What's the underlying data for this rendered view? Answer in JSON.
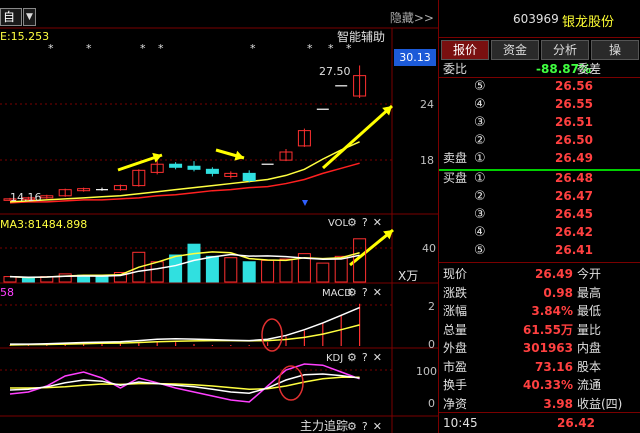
{
  "toolbar": {
    "watchlist_label": "自选",
    "dropdown_glyph": "▼",
    "hide_label": "隐藏>>"
  },
  "main_chart": {
    "ma_label": "E:15.253",
    "smart_assist_label": "智能辅助",
    "current_price_tag": "30.13",
    "high_label": "27.50",
    "low_label": "14.16",
    "axis_ticks": [
      "24",
      "18"
    ],
    "markers": [
      "*",
      "*",
      "*",
      "*",
      "*",
      "*",
      "*",
      "*"
    ],
    "candles": [
      {
        "o": 14.3,
        "c": 14.4,
        "h": 14.5,
        "l": 14.2
      },
      {
        "o": 14.4,
        "c": 14.5,
        "h": 14.6,
        "l": 14.3
      },
      {
        "o": 14.5,
        "c": 14.7,
        "h": 14.8,
        "l": 14.4
      },
      {
        "o": 14.7,
        "c": 15.3,
        "h": 15.4,
        "l": 14.6
      },
      {
        "o": 15.2,
        "c": 15.4,
        "h": 15.5,
        "l": 15.1
      },
      {
        "o": 15.3,
        "c": 15.3,
        "h": 15.5,
        "l": 15.2
      },
      {
        "o": 15.3,
        "c": 15.7,
        "h": 15.8,
        "l": 15.2
      },
      {
        "o": 15.7,
        "c": 17.2,
        "h": 17.3,
        "l": 15.6
      },
      {
        "o": 17.0,
        "c": 17.8,
        "h": 18.3,
        "l": 16.8
      },
      {
        "o": 17.8,
        "c": 17.5,
        "h": 18.0,
        "l": 17.3
      },
      {
        "o": 17.6,
        "c": 17.3,
        "h": 18.1,
        "l": 17.1
      },
      {
        "o": 17.3,
        "c": 16.9,
        "h": 17.5,
        "l": 16.6
      },
      {
        "o": 16.6,
        "c": 16.9,
        "h": 17.1,
        "l": 16.4
      },
      {
        "o": 16.9,
        "c": 16.2,
        "h": 17.2,
        "l": 16.0
      },
      {
        "o": 17.8,
        "c": 17.8,
        "h": 17.8,
        "l": 17.8
      },
      {
        "o": 18.2,
        "c": 19.0,
        "h": 19.3,
        "l": 18.1
      },
      {
        "o": 19.6,
        "c": 21.1,
        "h": 21.3,
        "l": 19.5
      },
      {
        "o": 23.2,
        "c": 23.2,
        "h": 23.2,
        "l": 23.2
      },
      {
        "o": 25.5,
        "c": 25.5,
        "h": 25.5,
        "l": 25.5
      },
      {
        "o": 24.5,
        "c": 26.5,
        "h": 27.5,
        "l": 24.3
      }
    ],
    "ma_lines": {
      "yellow": [
        14.1,
        14.2,
        14.3,
        14.4,
        14.5,
        14.6,
        14.7,
        14.9,
        15.1,
        15.3,
        15.5,
        15.7,
        15.9,
        16.1,
        16.3,
        16.7,
        17.3,
        18.3,
        19.2,
        20.0
      ],
      "red": [
        14.0,
        14.1,
        14.1,
        14.2,
        14.3,
        14.3,
        14.4,
        14.5,
        14.7,
        14.8,
        15.0,
        15.2,
        15.3,
        15.5,
        15.6,
        15.9,
        16.3,
        16.9,
        17.4,
        17.9
      ]
    }
  },
  "vol_panel": {
    "ma_label": "MA3:81484.898",
    "title": "VOL",
    "axis_tick": "40",
    "unit": "X万",
    "volumes": [
      4,
      3,
      4,
      6,
      5,
      4,
      7,
      22,
      15,
      20,
      28,
      19,
      18,
      15,
      16,
      17,
      21,
      14,
      19,
      32
    ],
    "colors": [
      "r",
      "c",
      "r",
      "r",
      "c",
      "c",
      "r",
      "r",
      "r",
      "c",
      "c",
      "c",
      "r",
      "c",
      "r",
      "r",
      "r",
      "r",
      "r",
      "r"
    ]
  },
  "macd_panel": {
    "side_label": "58",
    "title": "MACD",
    "axis_ticks": [
      "2",
      "0"
    ],
    "bars": [
      0.05,
      0.05,
      0.05,
      0.1,
      0.1,
      0.1,
      0.15,
      0.2,
      0.25,
      0.2,
      0.1,
      0.05,
      0.05,
      0.05,
      0.2,
      0.5,
      0.8,
      1.2,
      1.6,
      2.2
    ],
    "dif": [
      0.1,
      0.1,
      0.12,
      0.15,
      0.18,
      0.2,
      0.22,
      0.28,
      0.35,
      0.38,
      0.36,
      0.33,
      0.3,
      0.28,
      0.35,
      0.55,
      0.85,
      1.2,
      1.6,
      2.0
    ],
    "dea": [
      0.05,
      0.07,
      0.08,
      0.1,
      0.12,
      0.14,
      0.15,
      0.18,
      0.22,
      0.25,
      0.27,
      0.28,
      0.28,
      0.27,
      0.28,
      0.34,
      0.45,
      0.62,
      0.85,
      1.1
    ]
  },
  "kdj_panel": {
    "title": "KDJ",
    "axis_ticks": [
      "100",
      "0"
    ],
    "k": [
      50,
      52,
      58,
      68,
      75,
      72,
      62,
      70,
      66,
      62,
      58,
      52,
      45,
      42,
      55,
      75,
      88,
      90,
      86,
      80
    ],
    "d": [
      55,
      55,
      56,
      58,
      62,
      65,
      64,
      66,
      66,
      65,
      63,
      60,
      56,
      52,
      53,
      60,
      70,
      78,
      82,
      82
    ],
    "j": [
      40,
      45,
      60,
      85,
      95,
      80,
      55,
      80,
      68,
      55,
      45,
      35,
      25,
      20,
      60,
      100,
      115,
      112,
      95,
      78
    ]
  },
  "bottom_panel": {
    "title": "主力追踪"
  },
  "quote": {
    "code": "603969",
    "name": "银龙股份",
    "tabs": [
      "报价",
      "资金",
      "分析",
      "操"
    ],
    "ratio_label": "委比",
    "ratio_value": "-88.87%",
    "ratio_diff_label": "委差",
    "sell_label": "卖盘",
    "buy_label": "买盘",
    "asks": [
      {
        "num": "⑤",
        "price": "26.56"
      },
      {
        "num": "④",
        "price": "26.55"
      },
      {
        "num": "③",
        "price": "26.51"
      },
      {
        "num": "②",
        "price": "26.50"
      },
      {
        "num": "①",
        "price": "26.49"
      }
    ],
    "bids": [
      {
        "num": "①",
        "price": "26.48"
      },
      {
        "num": "②",
        "price": "26.47"
      },
      {
        "num": "③",
        "price": "26.45"
      },
      {
        "num": "④",
        "price": "26.42"
      },
      {
        "num": "⑤",
        "price": "26.41"
      }
    ],
    "stats": [
      {
        "label": "现价",
        "value": "26.49",
        "label2": "今开"
      },
      {
        "label": "涨跌",
        "value": "0.98",
        "label2": "最高"
      },
      {
        "label": "涨幅",
        "value": "3.84%",
        "label2": "最低"
      },
      {
        "label": "总量",
        "value": "61.55万",
        "label2": "量比"
      },
      {
        "label": "外盘",
        "value": "301963",
        "label2": "内盘"
      },
      {
        "label": "市盈",
        "value": "73.16",
        "label2": "股本"
      },
      {
        "label": "换手",
        "value": "40.33%",
        "label2": "流通"
      },
      {
        "label": "净资",
        "value": "3.98",
        "label2": "收益(四)"
      }
    ],
    "time": "10:45",
    "time_price": "26.42"
  },
  "colors": {
    "up": "#ff3030",
    "down": "#30e0e0",
    "ma_yellow": "#ffff40",
    "ma_red": "#ff2020",
    "ma_white": "#ffffff",
    "kdj_magenta": "#ff40ff",
    "arrow": "#ffff00",
    "panel_border": "#7a0000"
  }
}
